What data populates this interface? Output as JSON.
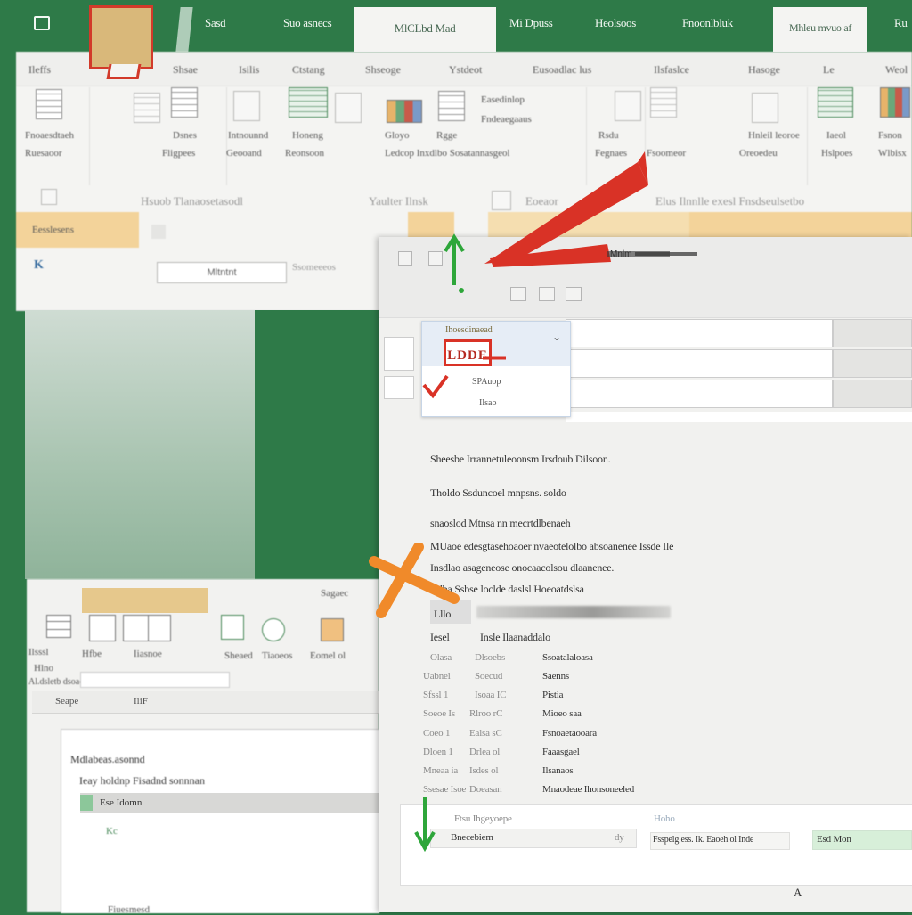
{
  "tabbar": {
    "tabs": [
      "Sasd",
      "Suo asnecs",
      "MlCLbd Mad",
      "Mi Dpuss",
      "Heolsoos",
      "Fnoonlbluk",
      "Mhleu mvuo af",
      "Ru"
    ],
    "active_index": 2
  },
  "ribbon": {
    "tabs": [
      "Ileffs",
      "Shsae",
      "Isilis",
      "Ctstang",
      "Shseoge",
      "Ystdeot",
      "Eusoadlac lus",
      "Ilsfaslce",
      "Hasoge",
      "Le",
      "Weol"
    ],
    "labels": [
      "Fnoaesdtaeh",
      "Ruesaoor",
      "Dsnes",
      "Fligpees",
      "Intnounnd",
      "Honeng",
      "Geooand",
      "Reonsoon",
      "Gloyo",
      "Rgge",
      "Easedinlop",
      "Fndeaegaaus",
      "Ledcop Inxdlbo Sosatannasgeol",
      "Rsdu",
      "Fegnaes",
      "Fsoomeor",
      "Hnleil leoroe",
      "Oreoedeu",
      "Iaeol",
      "Hslpoes",
      "Fsnon",
      "Wlbisx"
    ],
    "lower": {
      "field_label": "Hsuob Tlanaosetasodl",
      "value_label": "Yaulter Ilnsk",
      "options_label": "Elus Ilnnlle exesl Fnsdseulsetbo",
      "more_label": "Eoeaor",
      "orange_label": "Eesslesens",
      "input_value": "Mltntnt",
      "small_label": "Ssomeeeos",
      "toggle_label": "K"
    }
  },
  "dialog": {
    "title": "Mnlm",
    "dropdown": {
      "header": "Ihoesdinaead",
      "selected": "LDDE",
      "items": [
        "SPAuop",
        "Ilsao"
      ]
    },
    "lines": [
      "Sheesbe  Irrannetuleoonsm Irsdoub Dilsoon.",
      "Tholdo  Ssduncoel mnpsns. soldo",
      "snaoslod  Mtnsa nn mecrtdlbenaeh",
      "MUaoe edesgtasehoaoer nvaeotelolbo absoanenee Issde Ile",
      "Insdlao  asageneose onocaacolsou dlaanenee.",
      "Bdba  Ssbse loclde daslsl Hoeoatdslsa"
    ],
    "progress_label": "Lllo",
    "section_label": "Iesel",
    "section_value": "Insle Ilaanaddalo",
    "table": [
      {
        "a": "Olasa",
        "b": "Dlsoebs",
        "c": "Ssoatalaloasa"
      },
      {
        "a": "Uabnel",
        "b": "Soecud",
        "c": "Saenns"
      },
      {
        "a": "Sfssl 1",
        "b": "Isoaa IC",
        "c": "Pistia"
      },
      {
        "a": "Soeoe Is",
        "b": "Rlroo rC",
        "c": "Mioeo saa"
      },
      {
        "a": "Coeo 1",
        "b": "Ealsa sC",
        "c": "Fsnoaetaooara"
      },
      {
        "a": "Dloen 1",
        "b": "Drlea ol",
        "c": "Faaasgael"
      },
      {
        "a": "Mneaa ia",
        "b": "Isdes ol",
        "c": "Ilsanaos"
      },
      {
        "a": "Ssesae Isoe",
        "b": "Doeasan",
        "c": "Mnaodeae Ihonsoneeled"
      }
    ],
    "footer": {
      "label": "Ftsu Ihgeyoepe",
      "input_value": "Bnecebiem",
      "small_label": "Hoho",
      "count": "dy",
      "button1": "Fsspelg ess. Ik. Eaoeh ol Inde",
      "button2": "Esd Mon",
      "corner": "A"
    }
  },
  "bottom_panel": {
    "labels": [
      "Ilsssl",
      "Hlno",
      "Hfbe",
      "Iiasnoe",
      "Sheaed",
      "Tiaoeos",
      "Eomel ol",
      "Al.dsletb dsoaduesia",
      "Sagaec"
    ],
    "toolbar": [
      "Seape",
      "IliF"
    ],
    "sheet_title": "Mdlabeas.asonnd",
    "sheet_sub": "Ieay holdnp Fisadnd sonnnan",
    "bar_label": "Ese Idomn",
    "footer_label": "Fiuesmesd",
    "cell_mark": "Kc"
  },
  "colors": {
    "brand_green": "#2e7a48",
    "highlight_orange": "#f3d39a",
    "annotation_red": "#d93226",
    "annotation_orange": "#f08a2a",
    "annotation_green": "#2ea63a"
  }
}
